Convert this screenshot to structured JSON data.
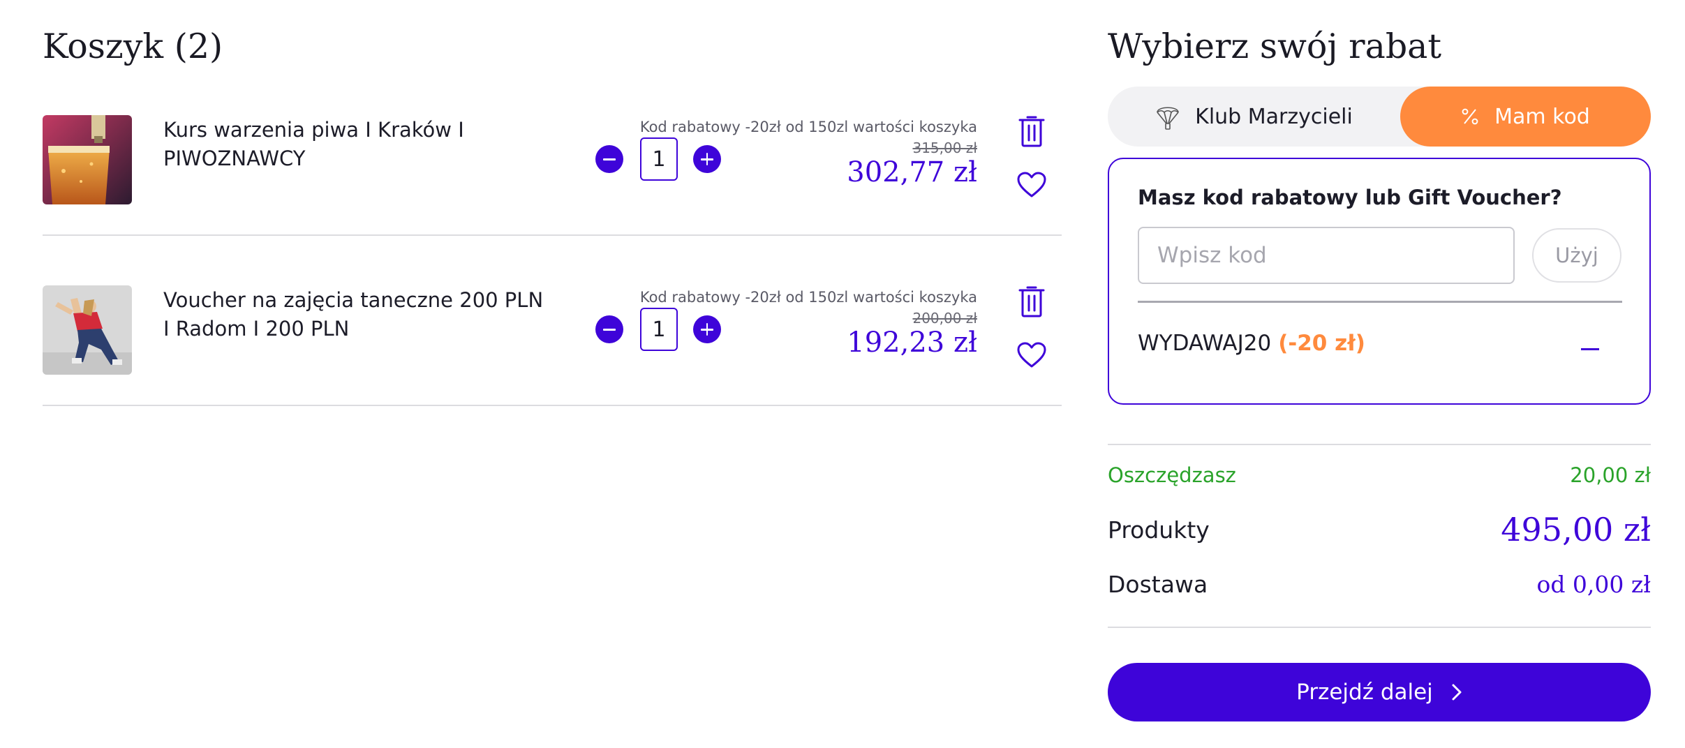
{
  "cart": {
    "title": "Koszyk (2)",
    "items": [
      {
        "name": "Kurs warzenia piwa I Kraków I PIWOZNAWCY",
        "quantity": "1",
        "promo_note": "Kod rabatowy -20zł od 150zl wartości koszyka",
        "old_price": "315,00 zł",
        "price": "302,77 zł",
        "image": "beer-tap-photo"
      },
      {
        "name": "Voucher na zajęcia taneczne 200 PLN I Radom I 200 PLN",
        "quantity": "1",
        "promo_note": "Kod rabatowy -20zł od 150zl wartości koszyka",
        "old_price": "200,00 zł",
        "price": "192,23 zł",
        "image": "dancer-photo"
      }
    ]
  },
  "discount": {
    "title": "Wybierz swój rabat",
    "tabs": [
      {
        "label": "Klub Marzycieli",
        "icon": "parachute-icon",
        "active": false
      },
      {
        "label": "Mam kod",
        "icon": "percent-icon",
        "active": true
      }
    ],
    "question": "Masz kod rabatowy lub Gift Voucher?",
    "input_placeholder": "Wpisz kod",
    "input_value": "",
    "use_button": "Użyj",
    "applied_code": "WYDAWAJ20",
    "applied_amount": "(-20 zł)"
  },
  "summary": {
    "savings_label": "Oszczędzasz",
    "savings_value": "20,00 zł",
    "products_label": "Produkty",
    "products_value": "495,00 zł",
    "shipping_label": "Dostawa",
    "shipping_value": "od 0,00 zł"
  },
  "checkout": {
    "label": "Przejdź dalej"
  },
  "colors": {
    "accent": "#3e04d9",
    "orange": "#ff8a3d",
    "savings_green": "#2aa32a",
    "divider": "#dcdce0"
  }
}
